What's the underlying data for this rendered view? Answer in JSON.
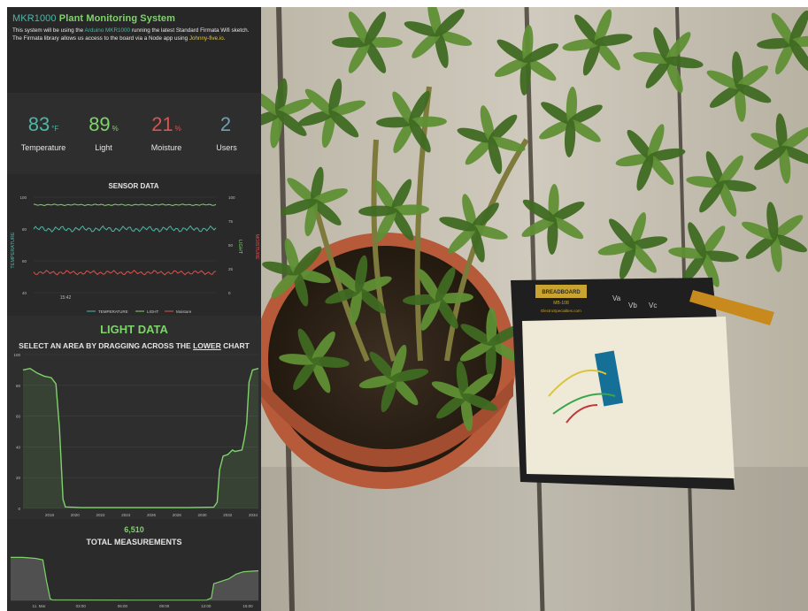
{
  "header": {
    "brand": "MKR1000",
    "title": "Plant Monitoring System",
    "desc_pre": "This system will be using the ",
    "board": "Arduino MKR1000",
    "desc_mid": " running the latest Standard Firmata Wifi sketch. The Firmata library allows us access to the board via a Node app using ",
    "lib_link": "Johnny-five.io",
    "desc_post": "."
  },
  "stats": [
    {
      "value": "83",
      "unit": "°F",
      "label": "Temperature",
      "color": "#4fb6a6"
    },
    {
      "value": "89",
      "unit": "%",
      "label": "Light",
      "color": "#7fd36b"
    },
    {
      "value": "21",
      "unit": "%",
      "label": "Moisture",
      "color": "#d9534f"
    },
    {
      "value": "2",
      "unit": "",
      "label": "Users",
      "color": "#6f9fb2"
    }
  ],
  "light_panel": {
    "title": "LIGHT DATA",
    "instruction_pre": "SELECT AN AREA BY DRAGGING ACROSS THE ",
    "instruction_em": "LOWER",
    "instruction_post": " CHART"
  },
  "total_panel": {
    "count": "6,510",
    "title": "TOTAL MEASUREMENTS"
  },
  "photo": {
    "breadboard_brand": "BREADBOARD",
    "breadboard_model": "MB-108",
    "breadboard_url": "ElectroSpecialties.com",
    "rail_labels": [
      "Va",
      "Vb",
      "Vc"
    ]
  },
  "chart_data": [
    {
      "type": "line",
      "title": "SENSOR DATA",
      "x_tick_labels": [
        "15:42"
      ],
      "ylabel_left": "TEMPERATURE",
      "ylabel_right_1": "LIGHT",
      "ylabel_right_2": "MOISTURE",
      "left_ticks": [
        "100",
        "80",
        "60",
        "40"
      ],
      "right_ticks": [
        "100",
        "75",
        "50",
        "25",
        "0"
      ],
      "ylim_left": [
        40,
        100
      ],
      "ylim_right": [
        0,
        100
      ],
      "legend": [
        "TEMPERATURE",
        "LIGHT",
        "Moisture"
      ],
      "legend_position": "bottom",
      "series": [
        {
          "name": "TEMPERATURE",
          "axis": "left",
          "color": "#4fb6a6",
          "base": 80,
          "amp": 1.2
        },
        {
          "name": "LIGHT",
          "axis": "right",
          "color": "#7fd36b",
          "base": 92,
          "amp": 0.5
        },
        {
          "name": "Moisture",
          "axis": "right",
          "color": "#d9534f",
          "base": 21,
          "amp": 1.5
        }
      ]
    },
    {
      "type": "area",
      "series_color": "#7fd36b",
      "ylim": [
        0,
        100
      ],
      "y_ticks": [
        "100",
        "80",
        "60",
        "40",
        "20",
        "0"
      ],
      "x_tick_labels": [
        "2018",
        "2020",
        "2022",
        "2024",
        "2026",
        "2028",
        "2030",
        "2032",
        "2034"
      ],
      "xlim": [
        0,
        100
      ],
      "points": [
        [
          0,
          90
        ],
        [
          3,
          91
        ],
        [
          6,
          88
        ],
        [
          9,
          86
        ],
        [
          12,
          85
        ],
        [
          14,
          81
        ],
        [
          15.5,
          52
        ],
        [
          17,
          6
        ],
        [
          18,
          1
        ],
        [
          25,
          0.5
        ],
        [
          40,
          0.5
        ],
        [
          55,
          0.5
        ],
        [
          70,
          0.5
        ],
        [
          81,
          0.8
        ],
        [
          82.5,
          4
        ],
        [
          83.5,
          25
        ],
        [
          85,
          34
        ],
        [
          87,
          35
        ],
        [
          89,
          38
        ],
        [
          90,
          37
        ],
        [
          93,
          38
        ],
        [
          94,
          45
        ],
        [
          95,
          55
        ],
        [
          96,
          82
        ],
        [
          97.5,
          90
        ],
        [
          100,
          91
        ]
      ]
    },
    {
      "type": "area",
      "series_color": "#7fd36b",
      "x_tick_labels": [
        "11. Mar",
        "03:00",
        "06:00",
        "09:00",
        "12:00",
        "15:00"
      ],
      "xlim": [
        0,
        100
      ],
      "ylim": [
        0,
        100
      ],
      "points": [
        [
          0,
          90
        ],
        [
          5,
          90
        ],
        [
          10,
          88
        ],
        [
          13,
          85
        ],
        [
          14.5,
          40
        ],
        [
          16,
          3
        ],
        [
          17,
          1
        ],
        [
          50,
          0.5
        ],
        [
          79,
          0.5
        ],
        [
          81,
          5
        ],
        [
          82,
          35
        ],
        [
          85,
          40
        ],
        [
          88,
          45
        ],
        [
          91,
          55
        ],
        [
          94,
          60
        ],
        [
          100,
          62
        ]
      ]
    }
  ]
}
